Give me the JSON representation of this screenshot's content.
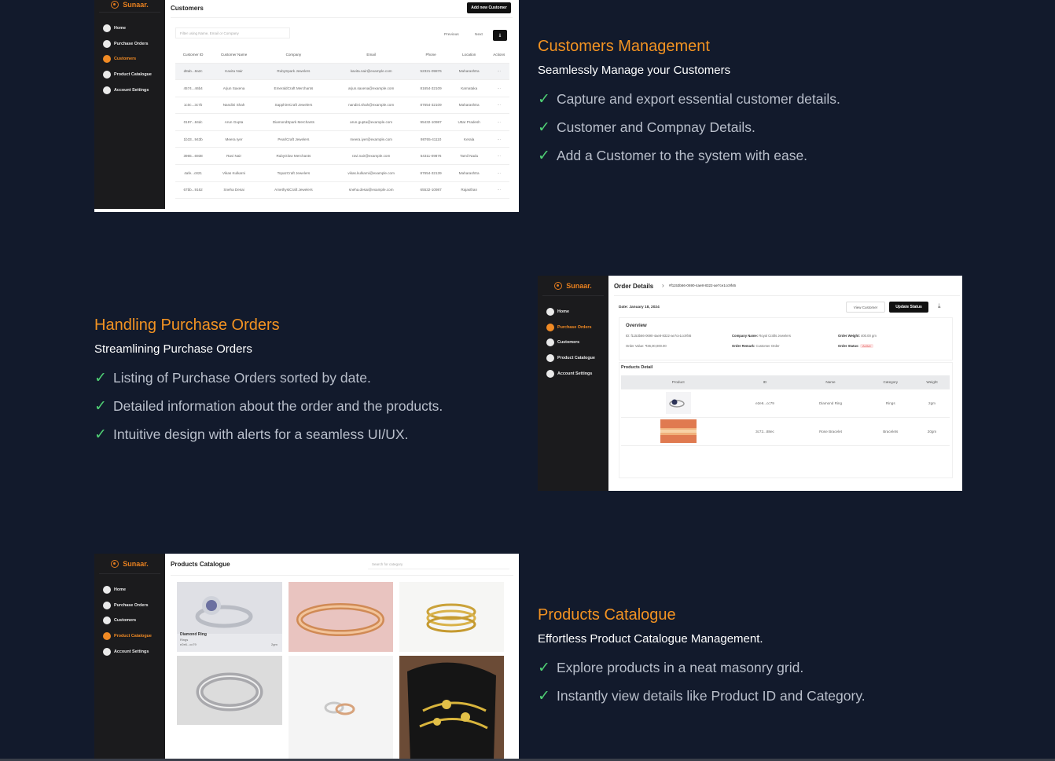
{
  "sections": [
    {
      "title": "Customers Management",
      "subtitle": "Seamlessly Manage your Customers",
      "bullets": [
        "Capture and export essential customer details.",
        "Customer and Compnay Details.",
        "Add a Customer to the system with ease."
      ]
    },
    {
      "title": "Handling Purchase Orders",
      "subtitle": "Streamlining Purchase Orders",
      "bullets": [
        "Listing of Purchase Orders sorted by date.",
        "Detailed information about the order and the products.",
        "Intuitive design with alerts for a seamless UI/UX."
      ]
    },
    {
      "title": "Products Catalogue",
      "subtitle": "Effortless Product Catalogue Management.",
      "bullets": [
        "Explore products in a neat masonry grid.",
        "Instantly view details like Product ID and Category."
      ]
    }
  ],
  "app": {
    "brand": "Sunaar.",
    "nav": [
      "Home",
      "Purchase Orders",
      "Customers",
      "Product Catalogue",
      "Account Settings"
    ],
    "accent": "#f08a24"
  },
  "customers_screen": {
    "title": "Customers",
    "add_button": "Add new Customer",
    "filter_placeholder": "Filter using Name, Email or Company",
    "prev": "Previous",
    "next": "Next",
    "columns": [
      "Customer ID",
      "Customer Name",
      "Company",
      "Email",
      "Phone",
      "Location",
      "Actions"
    ],
    "rows": [
      [
        "d8ab...8a2c",
        "Kavita Nair",
        "RubySpark Jewelers",
        "kavita.nair@example.com",
        "52321-09876",
        "Maharashtra",
        "···"
      ],
      [
        "4574...46b4",
        "Arjun Saxena",
        "EmeraldCraft Merchants",
        "arjun.saxena@example.com",
        "81654-32109",
        "Karnataka",
        "···"
      ],
      [
        "1c0c...3c7b",
        "Nandini Shah",
        "SapphireCraft Jewelers",
        "nandini.shah@example.com",
        "87654-32109",
        "Maharashtra",
        "···"
      ],
      [
        "0197...84dc",
        "Arun Gupta",
        "DiamondSpark Merchants",
        "arun.gupta@example.com",
        "95432-10987",
        "Uttar Pradesh",
        "···"
      ],
      [
        "1b33...943b",
        "Meera Iyer",
        "PearlCraft Jewelers",
        "meera.iyer@example.com",
        "98765-41110",
        "Kerala",
        "···"
      ],
      [
        "3965...6938",
        "Ravi Nair",
        "RubyGlow Merchants",
        "ravi.nair@example.com",
        "54311-09876",
        "Tamil Nadu",
        "···"
      ],
      [
        "4afe...c821",
        "Vikas Kulkarni",
        "TopazCraft Jewelers",
        "vikas.kulkarni@example.com",
        "87654-32139",
        "Maharashtra",
        "···"
      ],
      [
        "67bb...9162",
        "Sneha Desai",
        "AmethystCraft Jewelers",
        "sneha.desai@example.com",
        "65532-10987",
        "Rajasthan",
        "···"
      ]
    ]
  },
  "order_screen": {
    "title": "Order Details",
    "order_id": "#f1153b66-0690-4ae8-8322-ae7ce1cc9f46",
    "date": "Date: January 18, 2024",
    "view_customer": "View Customer",
    "update_status": "Update Status",
    "overview": "Overview",
    "id_line": "ID: f1153b66-0690-4ae8-8322-ae7ce1cc9f46",
    "order_value": "Order Value: ₹36,00,000.00",
    "company_name_label": "Company Name:",
    "company_name": "Royal Crafts Jewelers",
    "order_remark_label": "Order Remark:",
    "order_remark": "Customer Order",
    "order_weight_label": "Order Weight:",
    "order_weight": "400.00 gm",
    "order_status_label": "Order Status:",
    "order_status": "Active",
    "products_detail": "Products Detail",
    "columns": [
      "Product",
      "ID",
      "Name",
      "Category",
      "Weight"
    ],
    "rows": [
      [
        "",
        "e2e6...cc79",
        "Diamond Ring",
        "Rings",
        "2gm"
      ],
      [
        "",
        "3c72...88ec",
        "Rose Bracelet",
        "Bracelets",
        "20gm"
      ]
    ]
  },
  "catalogue_screen": {
    "title": "Products Catalogue",
    "search_placeholder": "Search for category",
    "first_card": {
      "name": "Diamond Ring",
      "category": "Rings",
      "id": "e2e6...cc79",
      "weight": "2gm"
    }
  }
}
